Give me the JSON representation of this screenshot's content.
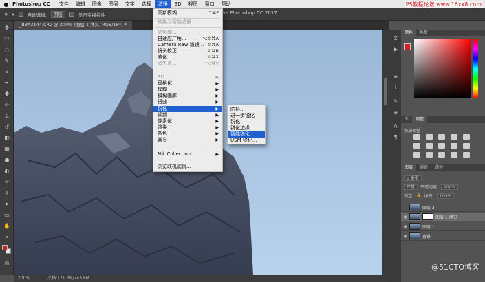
{
  "menubar": {
    "apple": "",
    "app_name": "Photoshop CC",
    "items": [
      "文件",
      "编辑",
      "图像",
      "图层",
      "文字",
      "选择",
      "滤镜",
      "3D",
      "视图",
      "窗口",
      "帮助"
    ],
    "active_item": "滤镜",
    "window_title": "be Photoshop CC 2017",
    "watermark_top": "PS教程论坛 www.16xx8.com"
  },
  "optbar": {
    "auto_select_label": "自动选择:",
    "auto_select_value": "图层",
    "show_transform": "显示变换控件"
  },
  "doc_tab": "_B8A3144.CR2 @ 200% (图层 1 拷贝, RGB/16*) *",
  "status": {
    "zoom": "200%",
    "doc": "文档:171.2M/743.6M"
  },
  "filter_menu": {
    "items": [
      {
        "label": "高斯模糊",
        "shortcut": "^⌘F",
        "disabled": false
      },
      {
        "label": "转换为智能滤镜",
        "shortcut": "",
        "disabled": true
      },
      {
        "label": "滤镜库...",
        "shortcut": "",
        "disabled": true
      },
      {
        "label": "自适应广角...",
        "shortcut": "⌥⇧⌘A",
        "disabled": false
      },
      {
        "label": "Camera Raw 滤镜...",
        "shortcut": "⇧⌘A",
        "disabled": false
      },
      {
        "label": "镜头校正...",
        "shortcut": "⇧⌘R",
        "disabled": false
      },
      {
        "label": "液化...",
        "shortcut": "⇧⌘X",
        "disabled": false
      },
      {
        "label": "消失点...",
        "shortcut": "⌥⌘V",
        "disabled": true
      },
      {
        "label": "3D",
        "disabled": true,
        "submenu": true
      },
      {
        "label": "风格化",
        "submenu": true
      },
      {
        "label": "模糊",
        "submenu": true
      },
      {
        "label": "模糊画廊",
        "submenu": true
      },
      {
        "label": "扭曲",
        "submenu": true
      },
      {
        "label": "锐化",
        "submenu": true,
        "highlighted": true
      },
      {
        "label": "视频",
        "submenu": true
      },
      {
        "label": "像素化",
        "submenu": true
      },
      {
        "label": "渲染",
        "submenu": true
      },
      {
        "label": "杂色",
        "submenu": true
      },
      {
        "label": "其它",
        "submenu": true
      },
      {
        "label": "Nik Collection",
        "submenu": true
      },
      {
        "label": "浏览联机滤镜..."
      }
    ]
  },
  "sharpen_submenu": {
    "items": [
      "防抖...",
      "进一步锐化",
      "锐化",
      "锐化边缘",
      "智能锐化...",
      "USM 锐化..."
    ],
    "highlighted": "智能锐化..."
  },
  "panels": {
    "color_tabs": [
      "颜色",
      "色板"
    ],
    "adjust_tabs": [
      "库",
      "调整"
    ],
    "adjust_title": "添加调整",
    "layer_tabs": [
      "图层",
      "通道",
      "路径"
    ],
    "kind_label": "ρ 类型",
    "blend_mode": "正常",
    "opacity_label": "不透明度:",
    "opacity_value": "100%",
    "lock_label": "锁定:",
    "fill_label": "填充:",
    "fill_value": "100%",
    "layers": [
      {
        "name": "图层 2",
        "visible": false,
        "selected": false,
        "mask": false
      },
      {
        "name": "图层 1 拷贝",
        "visible": true,
        "selected": true,
        "mask": true
      },
      {
        "name": "图层 1",
        "visible": true,
        "selected": false,
        "mask": false
      },
      {
        "name": "背景",
        "visible": true,
        "selected": false,
        "mask": false
      }
    ]
  },
  "watermark_bottom": "@51CTO博客",
  "colors": {
    "highlight": "#1f5fd0",
    "foreground": "#d02020"
  }
}
